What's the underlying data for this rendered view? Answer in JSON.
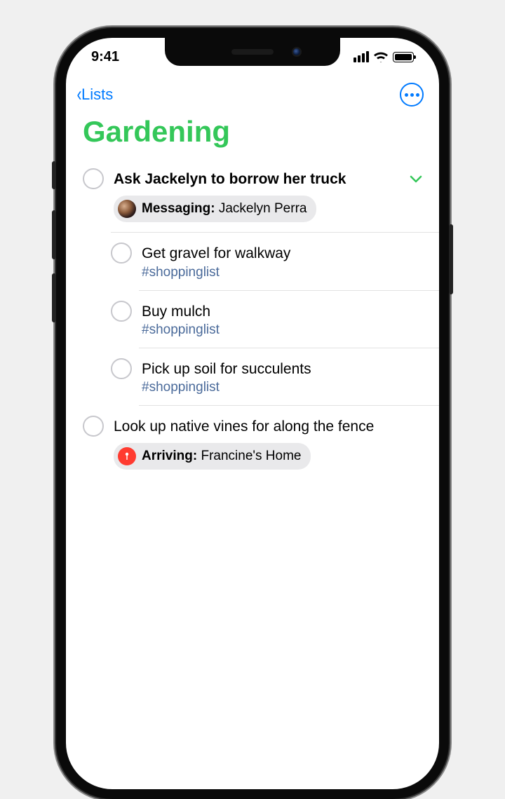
{
  "status": {
    "time": "9:41"
  },
  "nav": {
    "back_label": "Lists"
  },
  "page": {
    "title": "Gardening"
  },
  "colors": {
    "accent": "#34c759",
    "link": "#007aff",
    "tag": "#4a6a9a",
    "loc": "#ff3b30"
  },
  "reminders": [
    {
      "title": "Ask Jackelyn to borrow her truck",
      "bold": true,
      "expandable": true,
      "badge": {
        "type": "contact",
        "prefix": "Messaging:",
        "name": "Jackelyn Perra"
      },
      "subtasks": [
        {
          "title": "Get gravel for walkway",
          "tag": "#shoppinglist"
        },
        {
          "title": "Buy mulch",
          "tag": "#shoppinglist"
        },
        {
          "title": "Pick up soil for succulents",
          "tag": "#shoppinglist"
        }
      ]
    },
    {
      "title": "Look up native vines for along the fence",
      "badge": {
        "type": "location",
        "prefix": "Arriving:",
        "name": "Francine's Home"
      }
    }
  ]
}
